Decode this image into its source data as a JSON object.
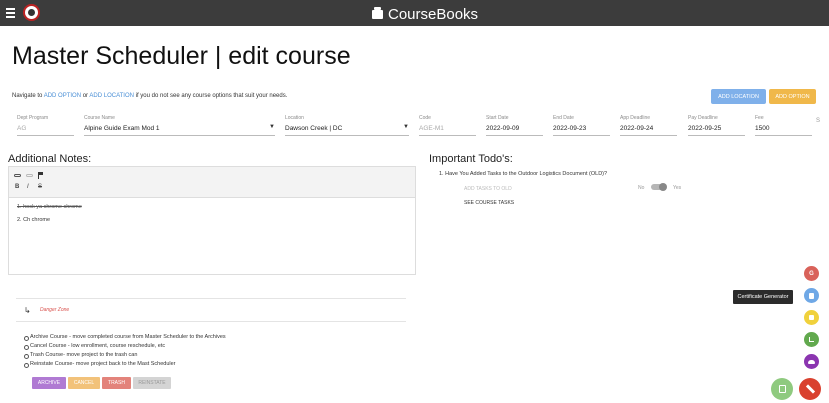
{
  "app": {
    "title": "CourseBooks"
  },
  "page": {
    "title": "Master Scheduler | edit course",
    "nav": {
      "prefix": "Navigate to",
      "add_option_link": "ADD OPTION",
      "middle": "or",
      "add_location_link": "ADD LOCATION",
      "suffix": "if you do not see any course options that suit your needs."
    },
    "buttons": {
      "add_location": "ADD LOCATION",
      "add_option": "ADD OPTION"
    }
  },
  "fields": {
    "dept_program": {
      "label": "Dept Program",
      "value": "AG"
    },
    "course_name": {
      "label": "Course Name",
      "value": "Alpine Guide Exam Mod 1"
    },
    "location": {
      "label": "Location",
      "value": "Dawson Creek | DC"
    },
    "code": {
      "label": "Code",
      "value": "AGE-M1"
    },
    "start_date": {
      "label": "Start Date",
      "value": "2022-09-09"
    },
    "end_date": {
      "label": "End Date",
      "value": "2022-09-23"
    },
    "app_deadline": {
      "label": "App Deadline",
      "value": "2022-09-24"
    },
    "pay_deadline": {
      "label": "Pay Deadline",
      "value": "2022-09-25"
    },
    "fee": {
      "label": "Fee",
      "value": "1500"
    },
    "overflow_label": "S"
  },
  "notes": {
    "heading": "Additional Notes:",
    "toolbar": {
      "bold": "B",
      "italic": "I",
      "strike": "S"
    },
    "lines": [
      "1. hock ya chrome chrome",
      "2. Ch chrome"
    ]
  },
  "todos": {
    "heading": "Important Todo's:",
    "item": "1. Have You Added Tasks to the Outdoor Logistics Document (OLD)?",
    "add_tasks": "ADD TASKS TO OLD",
    "see_tasks": "SEE COURSE TASKS",
    "no": "No",
    "yes": "Yes",
    "toggle_state": true
  },
  "danger": {
    "label": "Danger Zone",
    "items": [
      "Archive Course - move completed course from Master Scheduler to the Archives",
      "Cancel Course - low enrollment, course reschedule, etc",
      "Trash Course- move project to the trash can",
      "Reinstate Course- move project back to the Mast Scheduler"
    ],
    "buttons": {
      "archive": "ARCHIVE",
      "cancel": "CANCEL",
      "trash": "TRASH",
      "reinstate": "REINSTATE"
    }
  },
  "fabs": {
    "tooltip": "Certificate Generator",
    "g_label": "G",
    "colors": {
      "g": "#d9625a",
      "doc": "#6fa8e6",
      "note": "#f0d13c",
      "chart": "#62a94e",
      "people": "#8b35b0",
      "save": "#8fca7f",
      "tools": "#d9412f"
    }
  }
}
